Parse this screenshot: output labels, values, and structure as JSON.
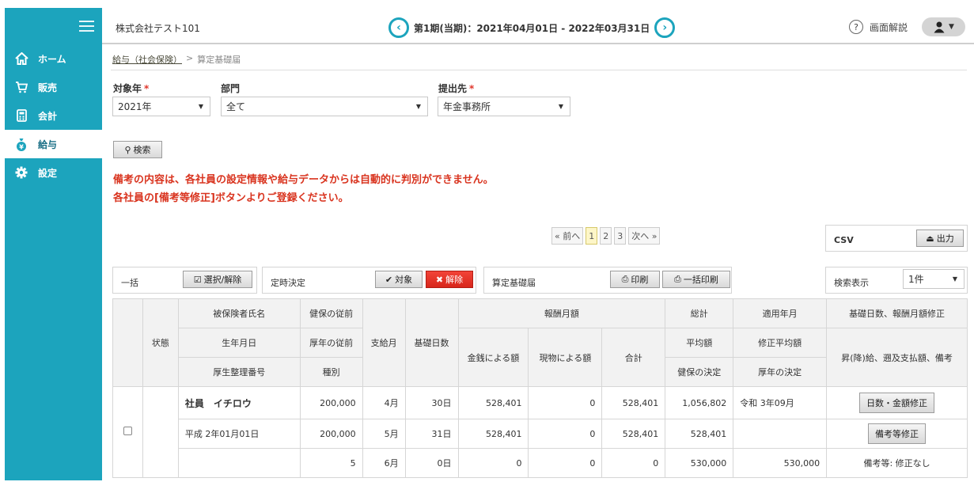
{
  "sidebar": {
    "items": [
      {
        "label": "ホーム",
        "icon": "home-icon"
      },
      {
        "label": "販売",
        "icon": "cart-icon"
      },
      {
        "label": "会計",
        "icon": "calculator-icon"
      },
      {
        "label": "給与",
        "icon": "money-bag-icon"
      },
      {
        "label": "設定",
        "icon": "gear-icon"
      }
    ],
    "active_index": 3,
    "color": "#1ca4bd"
  },
  "header": {
    "company": "株式会社テスト101",
    "period": "第1期(当期)：2021年04月01日 - 2022年03月31日",
    "help_label": "画面解説"
  },
  "breadcrumb": {
    "parent": "給与（社会保険）",
    "current": "算定基礎届"
  },
  "filters": {
    "year_label": "対象年",
    "year_value": "2021年",
    "dept_label": "部門",
    "dept_value": "全て",
    "dest_label": "提出先",
    "dest_value": "年金事務所",
    "required_mark": "*"
  },
  "search_button": "検索",
  "warnings": [
    "備考の内容は、各社員の設定情報や給与データからは自動的に判別ができません。",
    "各社員の[備考等修正]ボタンよりご登録ください。"
  ],
  "pagination": {
    "prev": "« 前へ",
    "pages": [
      "1",
      "2",
      "3"
    ],
    "current": "1",
    "next": "次へ »"
  },
  "csv": {
    "label": "CSV",
    "button": "出力"
  },
  "bulk": {
    "label": "一括",
    "button": "選択/解除"
  },
  "regular": {
    "label": "定時決定",
    "target_button": "対象",
    "remove_button": "解除"
  },
  "santei": {
    "label": "算定基礎届",
    "print_button": "印刷",
    "bulk_print_button": "一括印刷"
  },
  "page_size": {
    "label": "検索表示",
    "value": "1件"
  },
  "table": {
    "headers": {
      "status": "状態",
      "name": "被保険者氏名",
      "birth": "生年月日",
      "kousei_no": "厚生整理番号",
      "kenpo_prev": "健保の従前",
      "kounen_prev": "厚年の従前",
      "kind": "種別",
      "pay_month": "支給月",
      "base_days": "基礎日数",
      "remuneration": "報酬月額",
      "cash": "金銭による額",
      "in_kind": "現物による額",
      "subtotal": "合計",
      "total": "総計",
      "average": "平均額",
      "kenpo_decision": "健保の決定",
      "apply_month": "適用年月",
      "revised_avg": "修正平均額",
      "kounen_decision": "厚年の決定",
      "fix": "基礎日数、報酬月額修正",
      "notes": "昇(降)給、遡及支払額、備考"
    },
    "employee": {
      "name": "社員　イチロウ",
      "birth": "平成 2年01月01日",
      "kenpo_prev": "200,000",
      "kounen_prev": "200,000",
      "kind": "5",
      "total": "1,056,802",
      "average": "528,401",
      "kenpo_decision": "530,000",
      "apply_month": "令和 3年09月",
      "kounen_decision": "530,000",
      "fix_button": "日数・金額修正",
      "notes_button": "備考等修正",
      "notes_text": "備考等: 修正なし",
      "rows": [
        {
          "month": "4月",
          "days": "30日",
          "cash": "528,401",
          "in_kind": "0",
          "sum": "528,401"
        },
        {
          "month": "5月",
          "days": "31日",
          "cash": "528,401",
          "in_kind": "0",
          "sum": "528,401"
        },
        {
          "month": "6月",
          "days": "0日",
          "cash": "0",
          "in_kind": "0",
          "sum": "0"
        }
      ]
    }
  }
}
